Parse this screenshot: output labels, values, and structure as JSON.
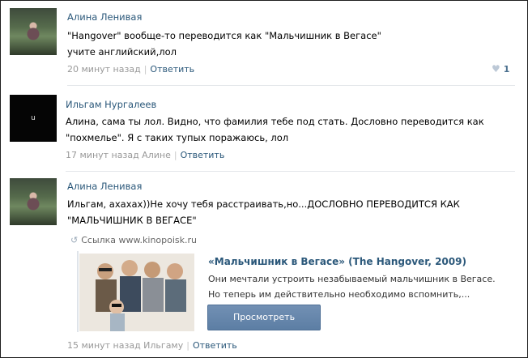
{
  "comments": [
    {
      "author": "Алина Ленивая",
      "lines": [
        "\"Hangover\" вообще-то переводится как \"Мальчишник в Вегасе\"",
        "учите английский,лол"
      ],
      "time": "20 минут назад",
      "reply_label": "Ответить",
      "likes": "1"
    },
    {
      "author": "Ильгам Нургалеев",
      "avatar_text": "u",
      "lines": [
        "Алина, сама ты лол. Видно, что фамилия тебе под стать. Дословно переводится как",
        "\"похмелье\". Я с таких тупых поражаюсь, лол"
      ],
      "time": "17 минут назад Алине",
      "reply_label": "Ответить"
    },
    {
      "author": "Алина Ленивая",
      "lines": [
        "Ильгам, ахахах))Не хочу тебя расстраивать,но...ДОСЛОВНО ПЕРЕВОДИТСЯ КАК",
        "\"МАЛЬЧИШНИК В ВЕГАСЕ\""
      ],
      "link": "Ссылка www.kinopoisk.ru",
      "card": {
        "title": "«Мальчишник в Вегасе» (The Hangover, 2009)",
        "desc": [
          "Они мечтали устроить незабываемый мальчишник в Вегасе.",
          "Но теперь им действительно необходимо вспомнить,..."
        ],
        "button": "Просмотреть"
      },
      "time": "15 минут назад Ильгаму",
      "reply_label": "Ответить"
    }
  ],
  "colors": {
    "link": "#2b587a",
    "meta": "#999999",
    "button": "#5c7ea4"
  }
}
